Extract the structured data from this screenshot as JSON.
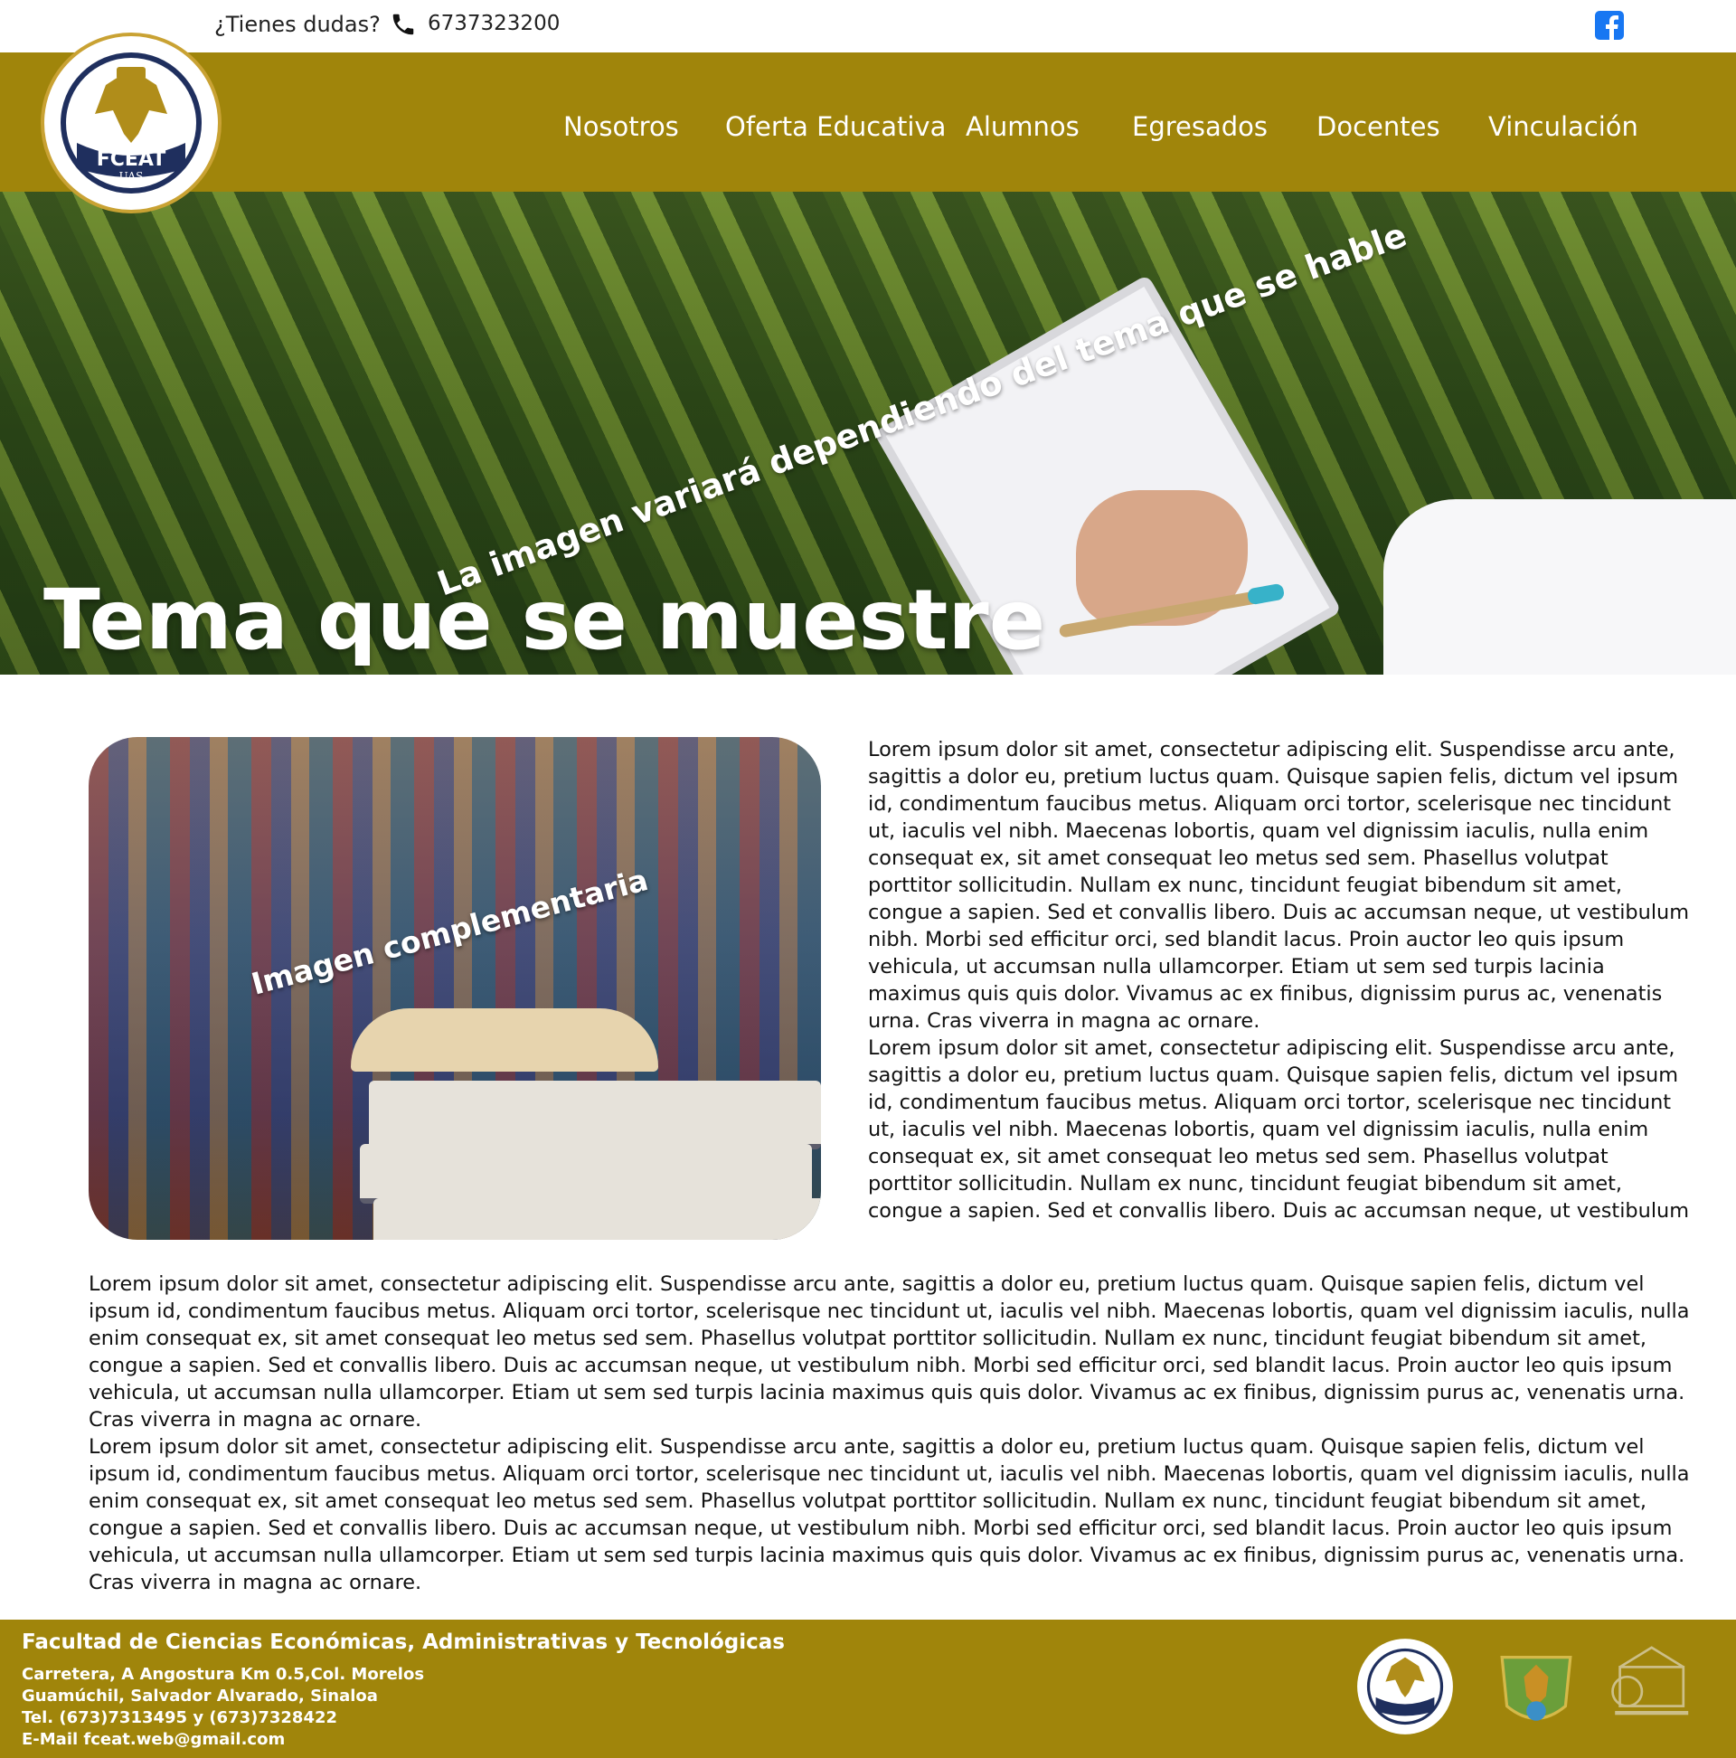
{
  "topbar": {
    "question": "¿Tienes dudas?",
    "phone": "6737323200",
    "phone_icon": "phone-icon",
    "social_icon": "facebook-icon"
  },
  "logo": {
    "acronym": "FCEAT",
    "uni": "UAS"
  },
  "nav": {
    "items": [
      {
        "label": "Nosotros"
      },
      {
        "label": "Oferta Educativa"
      },
      {
        "label": "Alumnos"
      },
      {
        "label": "Egresados"
      },
      {
        "label": "Docentes"
      },
      {
        "label": "Vinculación"
      }
    ]
  },
  "hero": {
    "caption": "La imagen variará dependiendo del tema que se hable",
    "title": "Tema que se muestre"
  },
  "complement": {
    "caption": "Imagen complementaria"
  },
  "body": {
    "right_paragraphs": [
      "Lorem ipsum dolor sit amet, consectetur adipiscing elit. Suspendisse arcu ante, sagittis a dolor eu, pretium luctus quam. Quisque sapien felis, dictum vel ipsum id, condimentum faucibus metus. Aliquam orci tortor, scelerisque nec tincidunt ut, iaculis vel nibh. Maecenas lobortis, quam vel dignissim iaculis, nulla enim consequat ex, sit amet consequat leo metus sed sem. Phasellus volutpat porttitor sollicitudin. Nullam ex nunc, tincidunt feugiat bibendum sit amet, congue a sapien. Sed et convallis libero. Duis ac accumsan neque, ut vestibulum nibh. Morbi sed efficitur orci, sed blandit lacus. Proin auctor leo quis ipsum vehicula, ut accumsan nulla ullamcorper. Etiam ut sem sed turpis lacinia maximus quis quis dolor. Vivamus ac ex finibus, dignissim purus ac, venenatis urna. Cras viverra in magna ac ornare.",
      "Lorem ipsum dolor sit amet, consectetur adipiscing elit. Suspendisse arcu ante, sagittis a dolor eu, pretium luctus quam. Quisque sapien felis, dictum vel ipsum id, condimentum faucibus metus. Aliquam orci tortor, scelerisque nec tincidunt ut, iaculis vel nibh. Maecenas lobortis, quam vel dignissim iaculis, nulla enim consequat ex, sit amet consequat leo metus sed sem. Phasellus volutpat porttitor sollicitudin. Nullam ex nunc, tincidunt feugiat bibendum sit amet, congue a sapien. Sed et convallis libero. Duis ac accumsan neque, ut vestibulum"
    ],
    "full_paragraphs": [
      "Lorem ipsum dolor sit amet, consectetur adipiscing elit. Suspendisse arcu ante, sagittis a dolor eu, pretium luctus quam. Quisque sapien felis, dictum vel ipsum id, condimentum faucibus metus. Aliquam orci tortor, scelerisque nec tincidunt ut, iaculis vel nibh. Maecenas lobortis, quam vel dignissim iaculis, nulla enim consequat ex, sit amet consequat leo metus sed sem. Phasellus volutpat porttitor sollicitudin. Nullam ex nunc, tincidunt feugiat bibendum sit amet, congue a sapien. Sed et convallis libero. Duis ac accumsan neque, ut vestibulum nibh. Morbi sed efficitur orci, sed blandit lacus. Proin auctor leo quis ipsum vehicula, ut accumsan nulla ullamcorper. Etiam ut sem sed turpis lacinia maximus quis quis dolor. Vivamus ac ex finibus, dignissim purus ac, venenatis urna. Cras viverra in magna ac ornare.",
      "Lorem ipsum dolor sit amet, consectetur adipiscing elit. Suspendisse arcu ante, sagittis a dolor eu, pretium luctus quam. Quisque sapien felis, dictum vel ipsum id, condimentum faucibus metus. Aliquam orci tortor, scelerisque nec tincidunt ut, iaculis vel nibh. Maecenas lobortis, quam vel dignissim iaculis, nulla enim consequat ex, sit amet consequat leo metus sed sem. Phasellus volutpat porttitor sollicitudin. Nullam ex nunc, tincidunt feugiat bibendum sit amet, congue a sapien. Sed et convallis libero. Duis ac accumsan neque, ut vestibulum nibh. Morbi sed efficitur orci, sed blandit lacus. Proin auctor leo quis ipsum vehicula, ut accumsan nulla ullamcorper. Etiam ut sem sed turpis lacinia maximus quis quis dolor. Vivamus ac ex finibus, dignissim purus ac, venenatis urna. Cras viverra in magna ac ornare."
    ]
  },
  "footer": {
    "name": "Facultad de Ciencias Económicas, Administrativas y Tecnológicas",
    "address1": "Carretera, A Angostura Km 0.5,Col. Morelos",
    "address2": "Guamúchil, Salvador Alvarado, Sinaloa",
    "tel": "Tel. (673)7313495 y (673)7328422",
    "email": "E-Mail fceat.web@gmail.com",
    "logos": [
      "fceat-logo",
      "university-seal",
      "consolidacion-global-logo"
    ]
  },
  "colors": {
    "brand": "#a0850b",
    "facebook": "#1877f2",
    "logo_navy": "#1f2f5e"
  }
}
